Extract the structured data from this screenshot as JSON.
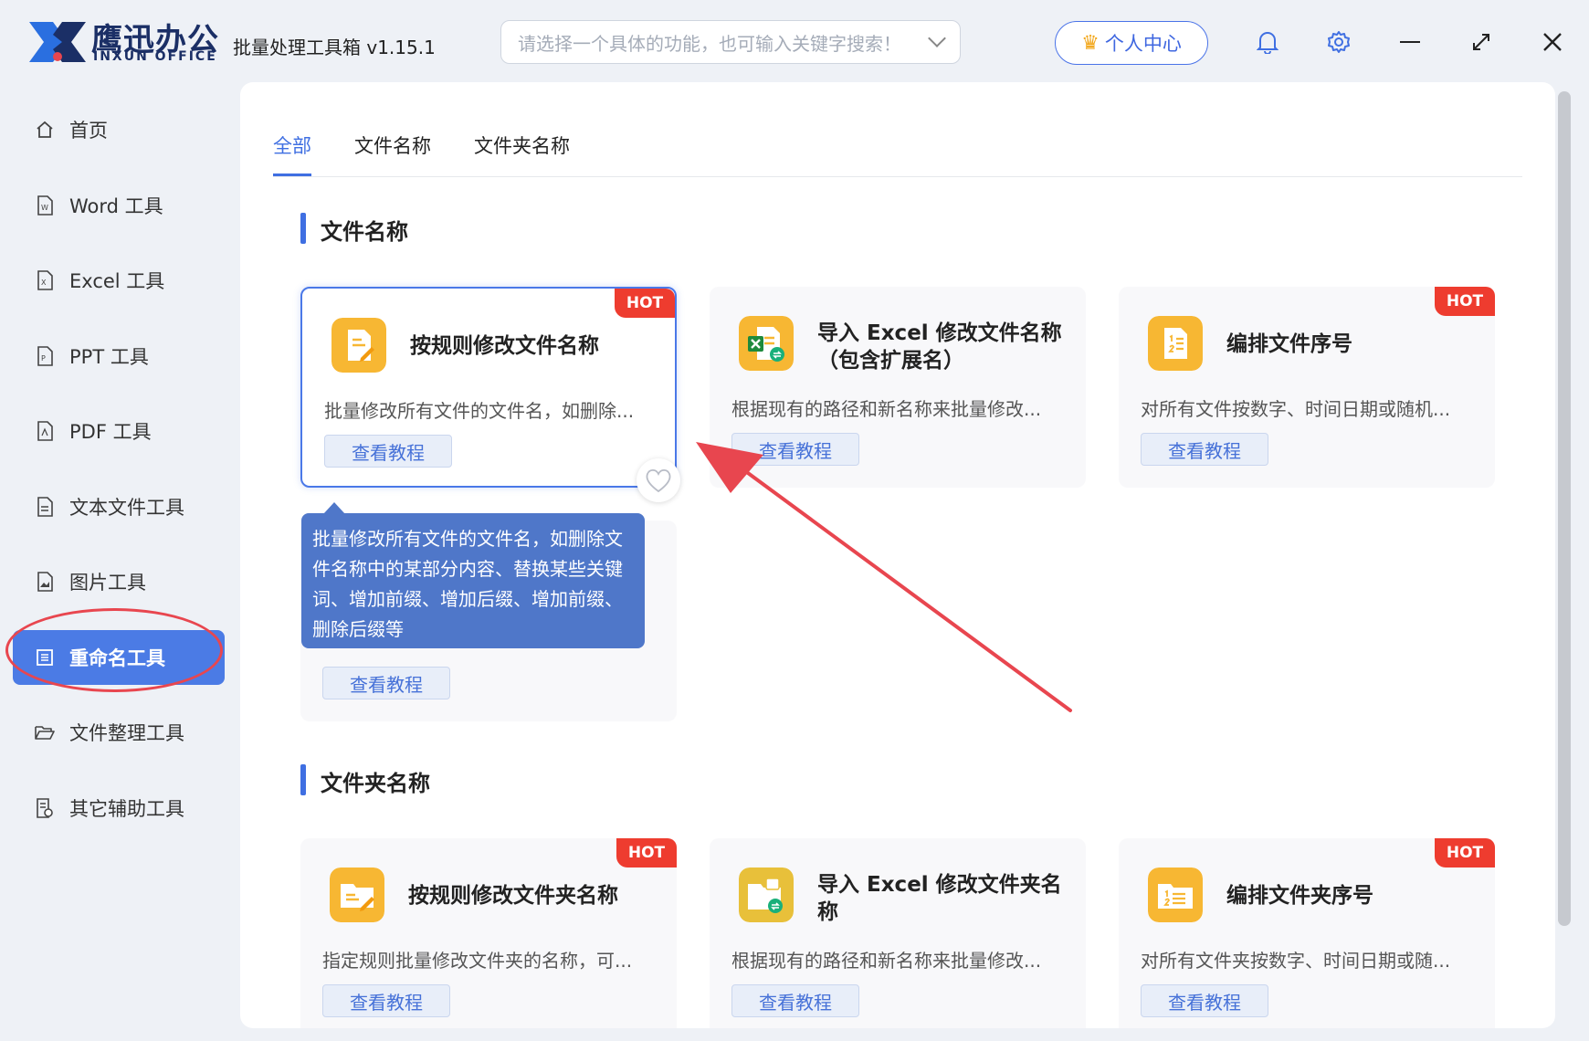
{
  "header": {
    "brand_cn": "鹰迅办公",
    "brand_en": "INXUN OFFICE",
    "app_title": "批量处理工具箱 v1.15.1",
    "search_placeholder": "请选择一个具体的功能，也可输入关键字搜索！",
    "user_center": "个人中心"
  },
  "sidebar": {
    "items": [
      {
        "label": "首页"
      },
      {
        "label": "Word 工具"
      },
      {
        "label": "Excel 工具"
      },
      {
        "label": "PPT 工具"
      },
      {
        "label": "PDF 工具"
      },
      {
        "label": "文本文件工具"
      },
      {
        "label": "图片工具"
      },
      {
        "label": "重命名工具"
      },
      {
        "label": "文件整理工具"
      },
      {
        "label": "其它辅助工具"
      }
    ]
  },
  "tabs": [
    "全部",
    "文件名称",
    "文件夹名称"
  ],
  "sections": [
    {
      "title": "文件名称",
      "cards": [
        {
          "title": "按规则修改文件名称",
          "desc": "批量修改所有文件的文件名，如删除...",
          "button": "查看教程",
          "hot": "HOT"
        },
        {
          "title": "导入 Excel 修改文件名称（包含扩展名）",
          "desc": "根据现有的路径和新名称来批量修改...",
          "button": "查看教程"
        },
        {
          "title": "编排文件序号",
          "desc": "对所有文件按数字、时间日期或随机...",
          "button": "查看教程",
          "hot": "HOT"
        },
        {
          "button": "查看教程"
        }
      ]
    },
    {
      "title": "文件夹名称",
      "cards": [
        {
          "title": "按规则修改文件夹名称",
          "desc": "指定规则批量修改文件夹的名称，可...",
          "button": "查看教程",
          "hot": "HOT"
        },
        {
          "title": "导入 Excel 修改文件夹名称",
          "desc": "根据现有的路径和新名称来批量修改...",
          "button": "查看教程"
        },
        {
          "title": "编排文件夹序号",
          "desc": "对所有文件夹按数字、时间日期或随...",
          "button": "查看教程",
          "hot": "HOT"
        }
      ]
    }
  ],
  "tooltip": "批量修改所有文件的文件名，如删除文件名称中的某部分内容、替换某些关键词、增加前缀、增加后缀、增加前缀、删除后缀等",
  "colors": {
    "accent": "#3f6fe2",
    "hot": "#ee3c2f",
    "annotation": "#e8464f"
  }
}
